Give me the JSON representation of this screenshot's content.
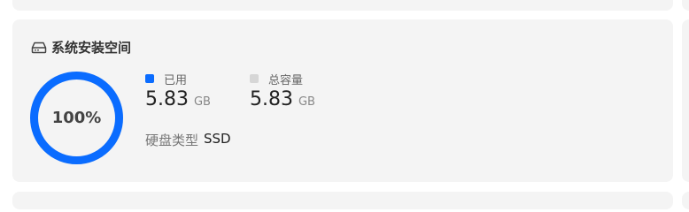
{
  "panel": {
    "title": "系统安装空间",
    "icon": "hard-drive-icon"
  },
  "usage": {
    "percent_label": "100%",
    "fraction": 1.0,
    "accent_color": "#0a6cff"
  },
  "used": {
    "label": "已用",
    "value": "5.83",
    "unit": "GB",
    "color": "#0a6cff"
  },
  "total": {
    "label": "总容量",
    "value": "5.83",
    "unit": "GB",
    "color": "#d6d6d6"
  },
  "disk": {
    "type_label": "硬盘类型",
    "type_value": "SSD"
  }
}
